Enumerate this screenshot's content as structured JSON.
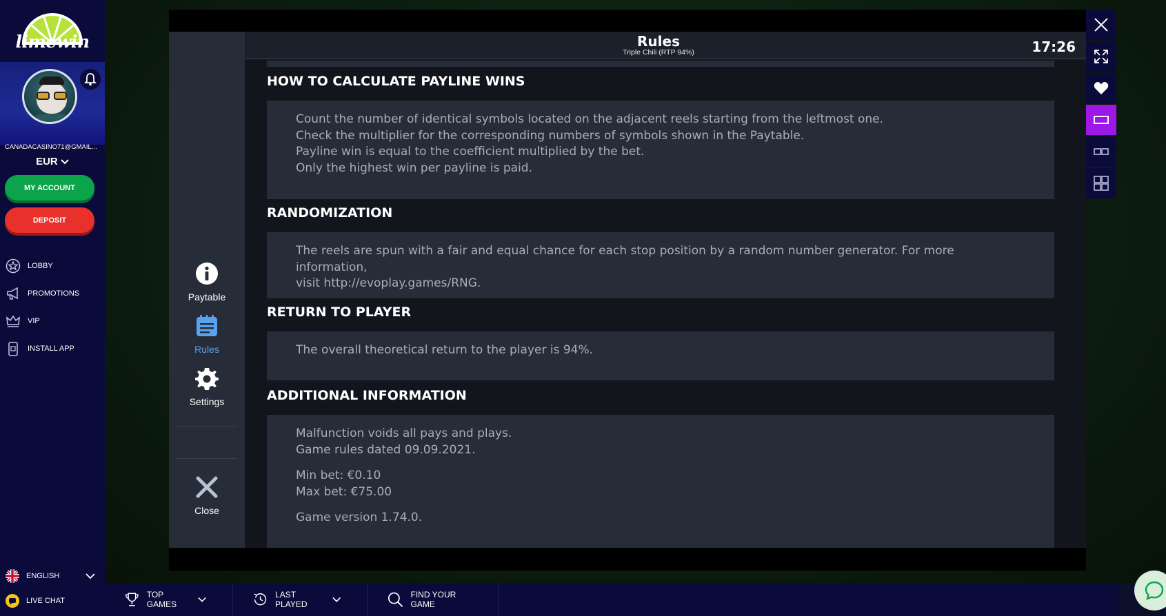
{
  "brand": {
    "name": "limewin"
  },
  "user": {
    "email": "CANADACASINO71@GMAIL...",
    "currency": "EUR"
  },
  "sidebar": {
    "account_label": "MY ACCOUNT",
    "deposit_label": "DEPOSIT",
    "items": [
      {
        "label": "LOBBY",
        "icon": "star-icon"
      },
      {
        "label": "PROMOTIONS",
        "icon": "megaphone-icon"
      },
      {
        "label": "VIP",
        "icon": "crown-icon"
      },
      {
        "label": "INSTALL APP",
        "icon": "phone-icon"
      }
    ],
    "language": "ENGLISH",
    "live_chat": "LIVE CHAT"
  },
  "rules": {
    "title": "Rules",
    "subtitle": "Triple Chili (RTP 94%)",
    "clock": "17:26",
    "menu": {
      "paytable": "Paytable",
      "rules": "Rules",
      "settings": "Settings",
      "close": "Close"
    },
    "sections": [
      {
        "title": "HOW TO CALCULATE PAYLINE WINS",
        "lines": [
          "Count the number of identical symbols located on the adjacent reels starting from the leftmost one.",
          "Check the multiplier for the corresponding numbers of symbols shown in the Paytable.",
          "Payline win is equal to the coefficient multiplied by the bet.",
          "Only the highest win per payline is paid."
        ]
      },
      {
        "title": "RANDOMIZATION",
        "lines": [
          "The reels are spun with a fair and equal chance for each stop position by a random number generator. For more information,",
          "visit http://evoplay.games/RNG."
        ]
      },
      {
        "title": "RETURN TO PLAYER",
        "lines": [
          "The overall theoretical return to the player is 94%."
        ]
      },
      {
        "title": "ADDITIONAL INFORMATION",
        "lines": [
          "Malfunction voids all pays and plays.",
          "Game rules dated 09.09.2021.",
          "Min bet: €0.10",
          "Max bet: €75.00",
          "Game version 1.74.0."
        ]
      }
    ]
  },
  "rail": [
    "close-icon",
    "expand-icon",
    "heart-icon",
    "single-view-icon",
    "dual-view-icon",
    "quad-view-icon"
  ],
  "bottom": {
    "top_games": "TOP GAMES",
    "last_played": "LAST PLAYED",
    "find_game": "FIND YOUR GAME"
  },
  "colors": {
    "sidebar_bg": "#0a0b3a",
    "account_green": "#0ba44b",
    "deposit_red": "#e8312a",
    "active_purple": "#9c17e8",
    "rules_active_blue": "#5aa1f0"
  }
}
